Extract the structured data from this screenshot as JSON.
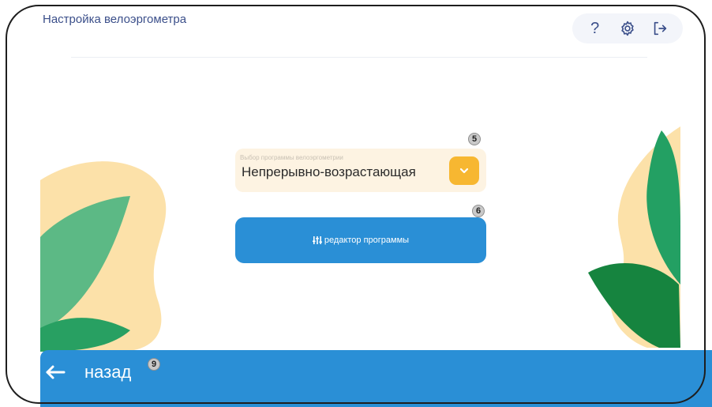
{
  "header": {
    "title": "Настройка велоэргометра",
    "help_icon": "question-icon",
    "settings_icon": "gear-icon",
    "exit_icon": "logout-icon"
  },
  "program_select": {
    "label": "Выбор программы велоэргометрии",
    "value": "Непрерывно-возрастающая",
    "marker": "5"
  },
  "editor_button": {
    "label": "редактор программы",
    "icon": "sliders-icon",
    "marker": "6"
  },
  "footer": {
    "back_label": "назад",
    "back_icon": "arrow-left-icon",
    "marker": "9"
  },
  "colors": {
    "accent_blue": "#2a8fd6",
    "select_bg": "#fdf3e2",
    "dropdown_button": "#f7b731",
    "leaf_green": "#23a063",
    "blob_yellow": "#fbdc9a"
  }
}
